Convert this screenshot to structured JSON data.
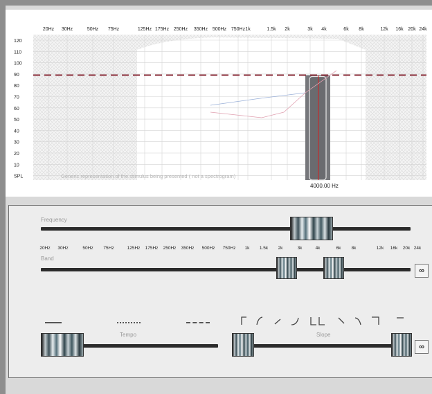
{
  "graph": {
    "freq_labels": [
      "20Hz",
      "30Hz",
      "50Hz",
      "75Hz",
      "125Hz",
      "175Hz",
      "250Hz",
      "350Hz",
      "500Hz",
      "750Hz",
      "1k",
      "1.5k",
      "2k",
      "3k",
      "4k",
      "6k",
      "8k",
      "12k",
      "16k",
      "20k",
      "24k"
    ],
    "spl_labels": [
      "120",
      "110",
      "100",
      "90",
      "80",
      "70",
      "60",
      "50",
      "40",
      "30",
      "20",
      "10",
      "SPL"
    ],
    "stimulus_note": "Generic representation of the stimulus being presented  ( not a spectrogram)",
    "frequency_readout": "4000.00 Hz",
    "reference_level_db": 89,
    "stimulus_center_hz": 4000,
    "colors": {
      "reference_line": "#8b2e3a",
      "stimulus_bar": "#76777b",
      "center_line": "#d22020"
    }
  },
  "controls": {
    "frequency": {
      "label": "Frequency"
    },
    "band": {
      "label": "Band"
    },
    "band_ticks": [
      "20Hz",
      "30Hz",
      "50Hz",
      "75Hz",
      "125Hz",
      "175Hz",
      "250Hz",
      "350Hz",
      "500Hz",
      "750Hz",
      "1k",
      "1.5k",
      "2k",
      "3k",
      "4k",
      "6k",
      "8k",
      "12k",
      "16k",
      "20k",
      "24k"
    ],
    "link_icon": "link-icon",
    "tempo": {
      "label": "Tempo"
    },
    "slope": {
      "label": "Slope"
    }
  }
}
